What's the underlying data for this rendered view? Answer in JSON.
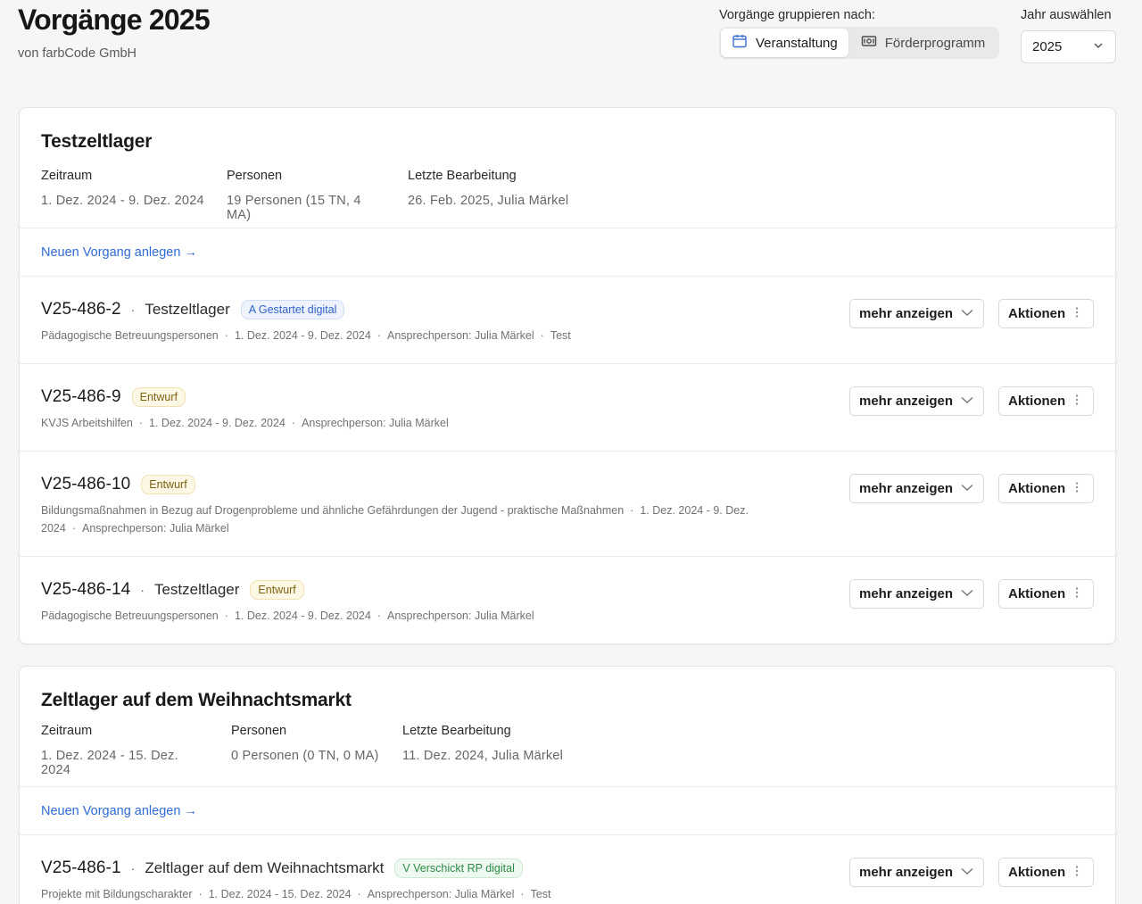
{
  "header": {
    "title": "Vorgänge 2025",
    "subtitle": "von farbCode GmbH",
    "group_label": "Vorgänge gruppieren nach:",
    "group_options": [
      {
        "label": "Veranstaltung",
        "icon": "calendar-icon",
        "active": true
      },
      {
        "label": "Förderprogramm",
        "icon": "money-icon",
        "active": false
      }
    ],
    "year_label": "Jahr auswählen",
    "year_value": "2025"
  },
  "labels": {
    "zeitraum": "Zeitraum",
    "personen": "Personen",
    "letzte": "Letzte Bearbeitung",
    "new_link": "Neuen Vorgang anlegen →",
    "more": "mehr anzeigen",
    "actions": "Aktionen"
  },
  "events": [
    {
      "title": "Testzeltlager",
      "zeitraum": "1. Dez. 2024 - 9. Dez. 2024",
      "personen": "19 Personen (15 TN, 4 MA)",
      "letzte": "26. Feb. 2025, Julia Märkel",
      "rows": [
        {
          "id": "V25-486-2",
          "event": "Testzeltlager",
          "badge": "A Gestartet digital",
          "badge_color": "#2f63c9",
          "details": [
            "Pädagogische Betreuungspersonen",
            "1. Dez. 2024 - 9. Dez. 2024",
            "Ansprechperson: Julia Märkel",
            "Test"
          ]
        },
        {
          "id": "V25-486-9",
          "event": "",
          "badge": "Entwurf",
          "badge_color": "#7c6112",
          "details": [
            "KVJS Arbeitshilfen",
            "1. Dez. 2024 - 9. Dez. 2024",
            "Ansprechperson: Julia Märkel"
          ]
        },
        {
          "id": "V25-486-10",
          "event": "",
          "badge": "Entwurf",
          "badge_color": "#7c6112",
          "details": [
            "Bildungsmaßnahmen in Bezug auf Drogenprobleme und ähnliche Gefährdungen der Jugend - praktische Maßnahmen",
            "1. Dez. 2024 - 9. Dez. 2024",
            "Ansprechperson: Julia Märkel"
          ]
        },
        {
          "id": "V25-486-14",
          "event": "Testzeltlager",
          "badge": "Entwurf",
          "badge_color": "#7c6112",
          "details": [
            "Pädagogische Betreuungspersonen",
            "1. Dez. 2024 - 9. Dez. 2024",
            "Ansprechperson: Julia Märkel"
          ]
        }
      ]
    },
    {
      "title": "Zeltlager auf dem Weihnachtsmarkt",
      "zeitraum": "1. Dez. 2024 - 15. Dez. 2024",
      "personen": "0 Personen (0 TN, 0 MA)",
      "letzte": "11. Dez. 2024, Julia Märkel",
      "rows": [
        {
          "id": "V25-486-1",
          "event": "Zeltlager auf dem Weihnachtsmarkt",
          "badge": "V Verschickt RP digital",
          "badge_color": "#2d8a45",
          "details": [
            "Projekte mit Bildungscharakter",
            "1. Dez. 2024 - 15. Dez. 2024",
            "Ansprechperson: Julia Märkel",
            "Test"
          ]
        }
      ]
    }
  ]
}
